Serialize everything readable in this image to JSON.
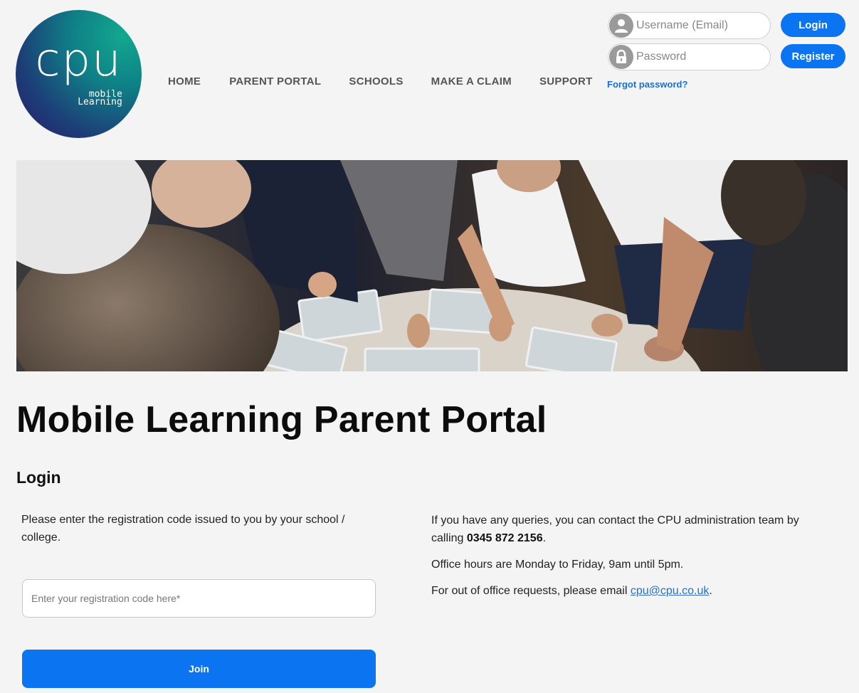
{
  "brand": {
    "logo_text": "cpu",
    "logo_subtext_line1": "mobile",
    "logo_subtext_line2": "Learning"
  },
  "nav": {
    "items": [
      {
        "label": "HOME"
      },
      {
        "label": "PARENT PORTAL"
      },
      {
        "label": "SCHOOLS"
      },
      {
        "label": "MAKE A CLAIM"
      },
      {
        "label": "SUPPORT"
      }
    ]
  },
  "auth": {
    "username_placeholder": "Username (Email)",
    "password_placeholder": "Password",
    "login_label": "Login",
    "register_label": "Register",
    "forgot_label": "Forgot password?",
    "user_icon": "user-icon",
    "lock_icon": "lock-icon"
  },
  "main": {
    "title": "Mobile Learning Parent Portal",
    "section_title": "Login",
    "instructions": "Please enter the registration code issued to you by your school / college.",
    "code_placeholder": "Enter your registration code here*",
    "join_label": "Join"
  },
  "contact": {
    "line1_prefix": "If you have any queries, you can contact the CPU administration team by calling ",
    "phone": "0345 872 2156",
    "line1_suffix": ".",
    "hours": "Office hours are Monday to Friday, 9am until 5pm.",
    "email_prefix": "For out of office requests, please email ",
    "email": "cpu@cpu.co.uk",
    "email_suffix": "."
  },
  "colors": {
    "accent": "#0b74f0",
    "background": "#f4f4f4",
    "link": "#2a6fc9"
  }
}
